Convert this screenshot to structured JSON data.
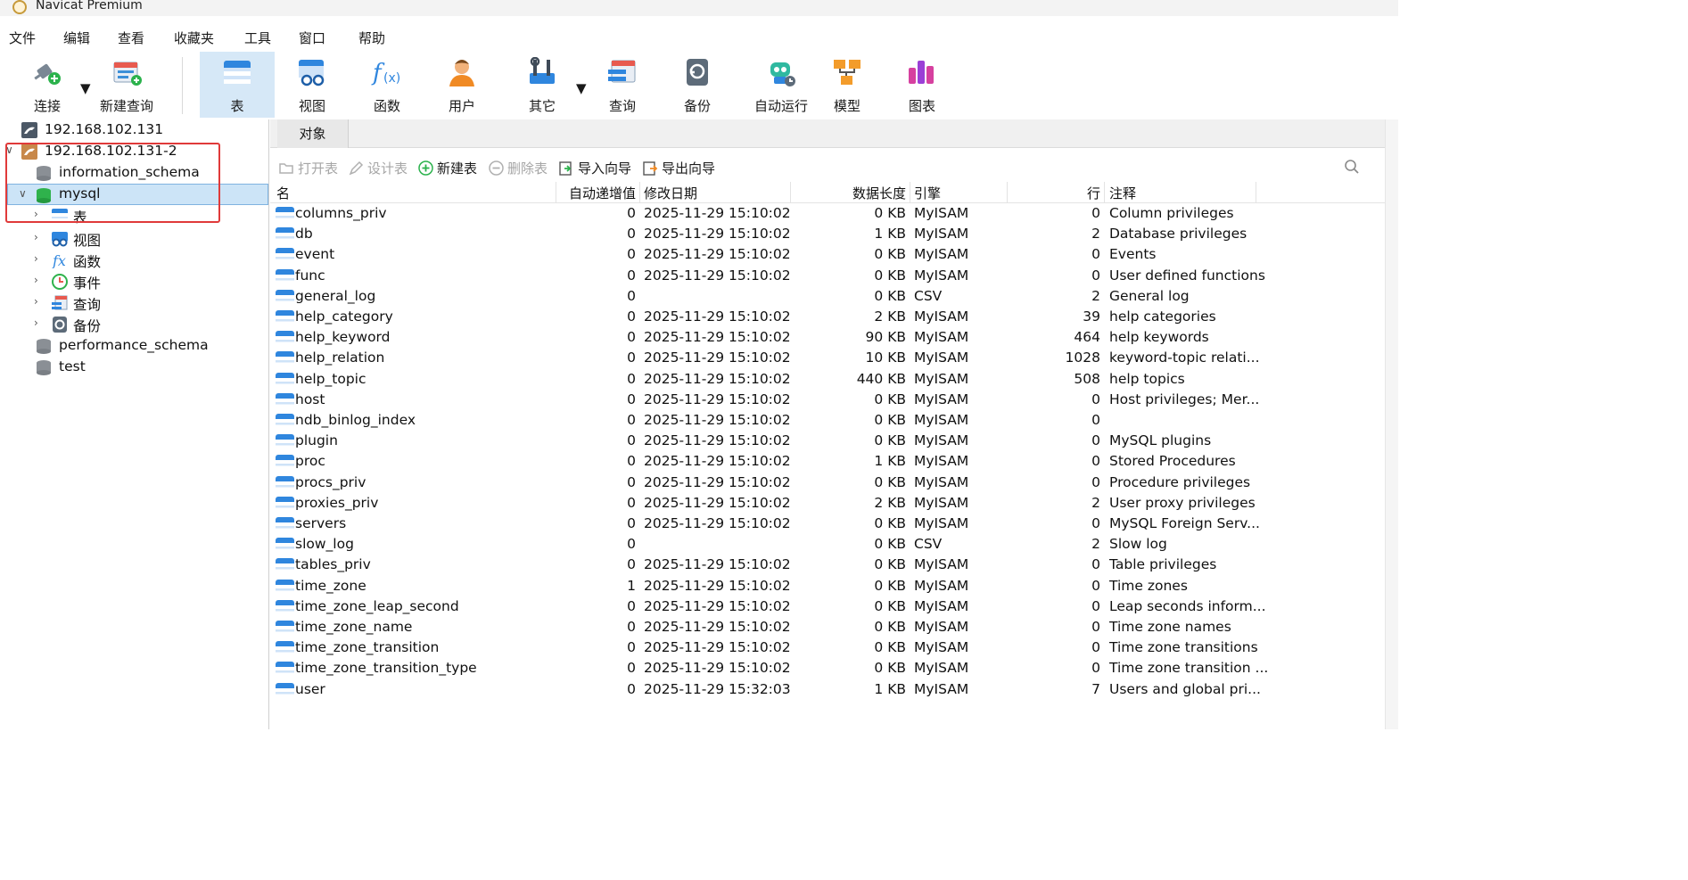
{
  "app": {
    "title": "Navicat Premium"
  },
  "menu": [
    "文件",
    "编辑",
    "查看",
    "收藏夹",
    "工具",
    "窗口",
    "帮助"
  ],
  "toolbar": {
    "items": [
      {
        "label": "连接",
        "icon": "connection-plug-icon"
      },
      {
        "label": "新建查询",
        "icon": "new-query-icon"
      },
      {
        "label": "表",
        "icon": "table-icon"
      },
      {
        "label": "视图",
        "icon": "view-icon"
      },
      {
        "label": "函数",
        "icon": "function-icon"
      },
      {
        "label": "用户",
        "icon": "user-icon"
      },
      {
        "label": "其它",
        "icon": "other-tools-icon"
      },
      {
        "label": "查询",
        "icon": "query-icon"
      },
      {
        "label": "备份",
        "icon": "backup-icon"
      },
      {
        "label": "自动运行",
        "icon": "robot-icon"
      },
      {
        "label": "模型",
        "icon": "model-icon"
      },
      {
        "label": "图表",
        "icon": "chart-icon"
      }
    ]
  },
  "tree": {
    "nodes": [
      {
        "label": "192.168.102.131",
        "icon": "mysql-connection-icon"
      },
      {
        "label": "192.168.102.131-2",
        "icon": "mysql-connection-icon"
      },
      {
        "label": "information_schema",
        "icon": "database-icon"
      },
      {
        "label": "mysql",
        "icon": "database-icon"
      },
      {
        "label": "表",
        "icon": "table-icon"
      },
      {
        "label": "视图",
        "icon": "view-icon"
      },
      {
        "label": "函数",
        "icon": "function-icon"
      },
      {
        "label": "事件",
        "icon": "event-clock-icon"
      },
      {
        "label": "查询",
        "icon": "query-icon"
      },
      {
        "label": "备份",
        "icon": "backup-icon"
      },
      {
        "label": "performance_schema",
        "icon": "database-icon"
      },
      {
        "label": "test",
        "icon": "database-icon"
      }
    ]
  },
  "objects": {
    "tab_label": "对象",
    "actions": [
      {
        "label": "打开表",
        "enabled": false
      },
      {
        "label": "设计表",
        "enabled": false
      },
      {
        "label": "新建表",
        "enabled": true
      },
      {
        "label": "删除表",
        "enabled": false
      },
      {
        "label": "导入向导",
        "enabled": true
      },
      {
        "label": "导出向导",
        "enabled": true
      }
    ],
    "columns": [
      "名",
      "自动递增值",
      "修改日期",
      "数据长度",
      "引擎",
      "行",
      "注释"
    ],
    "rows": [
      [
        "columns_priv",
        "0",
        "2025-11-29 15:10:02",
        "0 KB",
        "MyISAM",
        "0",
        "Column privileges"
      ],
      [
        "db",
        "0",
        "2025-11-29 15:10:02",
        "1 KB",
        "MyISAM",
        "2",
        "Database privileges"
      ],
      [
        "event",
        "0",
        "2025-11-29 15:10:02",
        "0 KB",
        "MyISAM",
        "0",
        "Events"
      ],
      [
        "func",
        "0",
        "2025-11-29 15:10:02",
        "0 KB",
        "MyISAM",
        "0",
        "User defined functions"
      ],
      [
        "general_log",
        "0",
        "",
        "0 KB",
        "CSV",
        "2",
        "General log"
      ],
      [
        "help_category",
        "0",
        "2025-11-29 15:10:02",
        "2 KB",
        "MyISAM",
        "39",
        "help categories"
      ],
      [
        "help_keyword",
        "0",
        "2025-11-29 15:10:02",
        "90 KB",
        "MyISAM",
        "464",
        "help keywords"
      ],
      [
        "help_relation",
        "0",
        "2025-11-29 15:10:02",
        "10 KB",
        "MyISAM",
        "1028",
        "keyword-topic relati..."
      ],
      [
        "help_topic",
        "0",
        "2025-11-29 15:10:02",
        "440 KB",
        "MyISAM",
        "508",
        "help topics"
      ],
      [
        "host",
        "0",
        "2025-11-29 15:10:02",
        "0 KB",
        "MyISAM",
        "0",
        "Host privileges;  Mer..."
      ],
      [
        "ndb_binlog_index",
        "0",
        "2025-11-29 15:10:02",
        "0 KB",
        "MyISAM",
        "0",
        ""
      ],
      [
        "plugin",
        "0",
        "2025-11-29 15:10:02",
        "0 KB",
        "MyISAM",
        "0",
        "MySQL plugins"
      ],
      [
        "proc",
        "0",
        "2025-11-29 15:10:02",
        "1 KB",
        "MyISAM",
        "0",
        "Stored Procedures"
      ],
      [
        "procs_priv",
        "0",
        "2025-11-29 15:10:02",
        "0 KB",
        "MyISAM",
        "0",
        "Procedure privileges"
      ],
      [
        "proxies_priv",
        "0",
        "2025-11-29 15:10:02",
        "2 KB",
        "MyISAM",
        "2",
        "User proxy privileges"
      ],
      [
        "servers",
        "0",
        "2025-11-29 15:10:02",
        "0 KB",
        "MyISAM",
        "0",
        "MySQL Foreign Serv..."
      ],
      [
        "slow_log",
        "0",
        "",
        "0 KB",
        "CSV",
        "2",
        "Slow log"
      ],
      [
        "tables_priv",
        "0",
        "2025-11-29 15:10:02",
        "0 KB",
        "MyISAM",
        "0",
        "Table privileges"
      ],
      [
        "time_zone",
        "1",
        "2025-11-29 15:10:02",
        "0 KB",
        "MyISAM",
        "0",
        "Time zones"
      ],
      [
        "time_zone_leap_second",
        "0",
        "2025-11-29 15:10:02",
        "0 KB",
        "MyISAM",
        "0",
        "Leap seconds inform..."
      ],
      [
        "time_zone_name",
        "0",
        "2025-11-29 15:10:02",
        "0 KB",
        "MyISAM",
        "0",
        "Time zone names"
      ],
      [
        "time_zone_transition",
        "0",
        "2025-11-29 15:10:02",
        "0 KB",
        "MyISAM",
        "0",
        "Time zone transitions"
      ],
      [
        "time_zone_transition_type",
        "0",
        "2025-11-29 15:10:02",
        "0 KB",
        "MyISAM",
        "0",
        "Time zone transition ..."
      ],
      [
        "user",
        "0",
        "2025-11-29 15:32:03",
        "1 KB",
        "MyISAM",
        "7",
        "Users and global pri..."
      ]
    ]
  },
  "colors": {
    "selection": "#cce4f7",
    "toolbar_active": "#d6e8f7",
    "highlight_box": "#e03a3a"
  }
}
